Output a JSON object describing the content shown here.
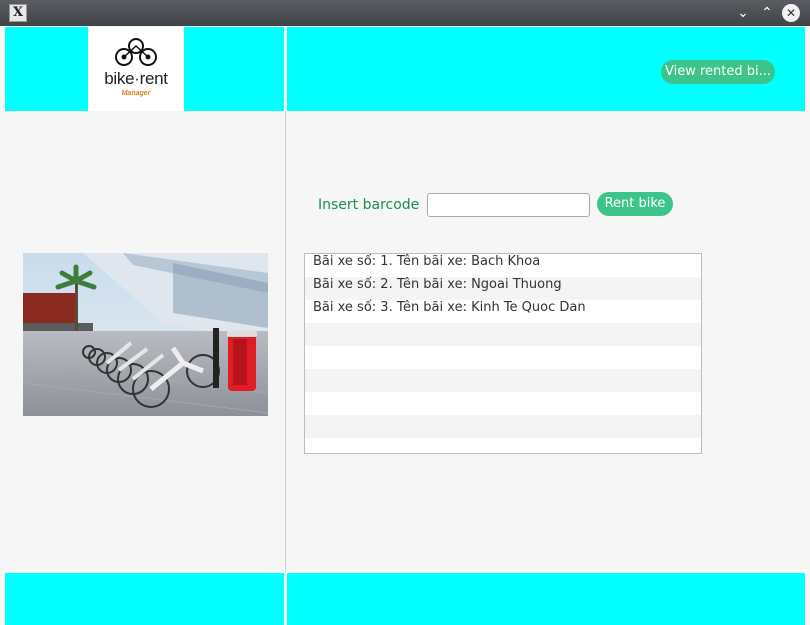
{
  "window": {
    "icon_glyph": "X",
    "controls": {
      "minimize": "⌄",
      "maximize": "⌃",
      "close": "✕"
    }
  },
  "header": {
    "logo_text": "bike·rent",
    "logo_sub": "Manager",
    "view_rented_label": "View rented bi..."
  },
  "form": {
    "insert_label": "Insert barcode",
    "barcode_value": "",
    "rent_label": "Rent bike"
  },
  "stations": [
    "Bãi xe số: 1. Tên bãi xe: Bach Khoa",
    "Bãi xe số: 2. Tên bãi xe: Ngoai Thuong",
    "Bãi xe số: 3. Tên bãi xe: Kinh Te Quoc Dan",
    "",
    "",
    "",
    "",
    "",
    ""
  ],
  "colors": {
    "accent_cyan": "#00ffff",
    "button_green": "#3cc48a",
    "label_green": "#1a8f4a",
    "logo_orange": "#e07b20"
  }
}
